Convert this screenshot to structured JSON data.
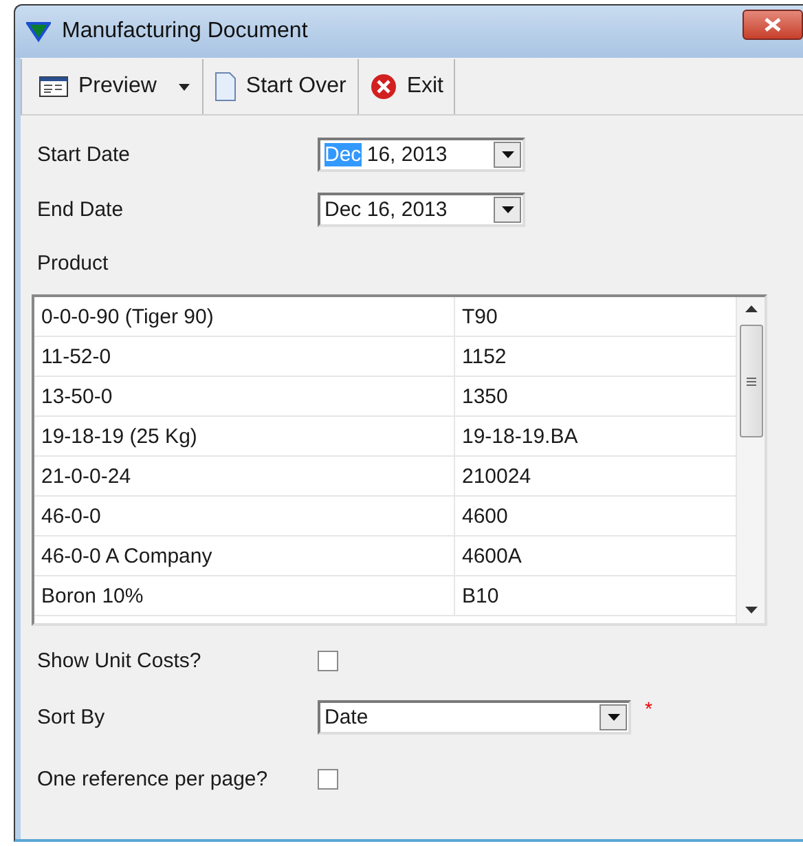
{
  "window": {
    "title": "Manufacturing Document"
  },
  "toolbar": [
    {
      "kind": "menu",
      "label": "Preview"
    },
    {
      "kind": "page",
      "label": "Start Over"
    },
    {
      "kind": "exit",
      "label": "Exit"
    }
  ],
  "start_date": {
    "label": "Start Date",
    "value_parts": [
      {
        "text": "Dec",
        "selected": true
      },
      {
        "text": " 16, 2013",
        "selected": false
      }
    ]
  },
  "end_date": {
    "label": "End Date",
    "value_parts": [
      {
        "text": "Dec 16, 2013",
        "selected": false
      }
    ]
  },
  "product": {
    "label": "Product",
    "rows": [
      [
        "0-0-0-90 (Tiger 90)",
        "T90"
      ],
      [
        "11-52-0",
        "1152"
      ],
      [
        "13-50-0",
        "1350"
      ],
      [
        "19-18-19 (25 Kg)",
        "19-18-19.BA"
      ],
      [
        "21-0-0-24",
        "210024"
      ],
      [
        "46-0-0",
        "4600"
      ],
      [
        "46-0-0 A Company",
        "4600A"
      ],
      [
        "Boron 10%",
        "B10"
      ]
    ]
  },
  "show_unit_costs": {
    "label": "Show Unit Costs?",
    "checked": false
  },
  "sort_by": {
    "label": "Sort By",
    "value": "Date",
    "required_mark": "*"
  },
  "one_reference": {
    "label": "One reference per page?",
    "checked": false
  }
}
